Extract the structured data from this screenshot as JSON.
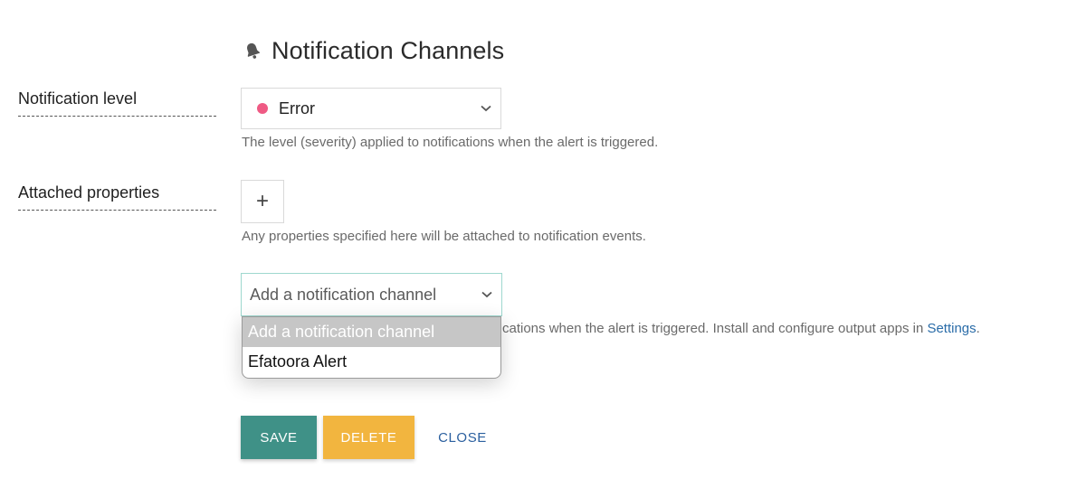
{
  "header": {
    "title": "Notification Channels",
    "icon": "bell-icon"
  },
  "notification_level": {
    "label": "Notification level",
    "selected": "Error",
    "status_color": "#ef5a84",
    "help": "The level (severity) applied to notifications when the alert is triggered."
  },
  "attached_properties": {
    "label": "Attached properties",
    "add_symbol": "+",
    "help": "Any properties specified here will be attached to notification events."
  },
  "channel": {
    "placeholder": "Add a notification channel",
    "help_visible": "cations when the alert is triggered. Install and configure output apps in ",
    "help_link": "Settings",
    "help_end": ".",
    "options": [
      "Add a notification channel",
      "Efatoora Alert"
    ]
  },
  "actions": {
    "save": "SAVE",
    "delete": "DELETE",
    "close": "CLOSE"
  },
  "colors": {
    "save": "#3f9187",
    "delete": "#f2b53f",
    "link": "#2a6ca8"
  }
}
